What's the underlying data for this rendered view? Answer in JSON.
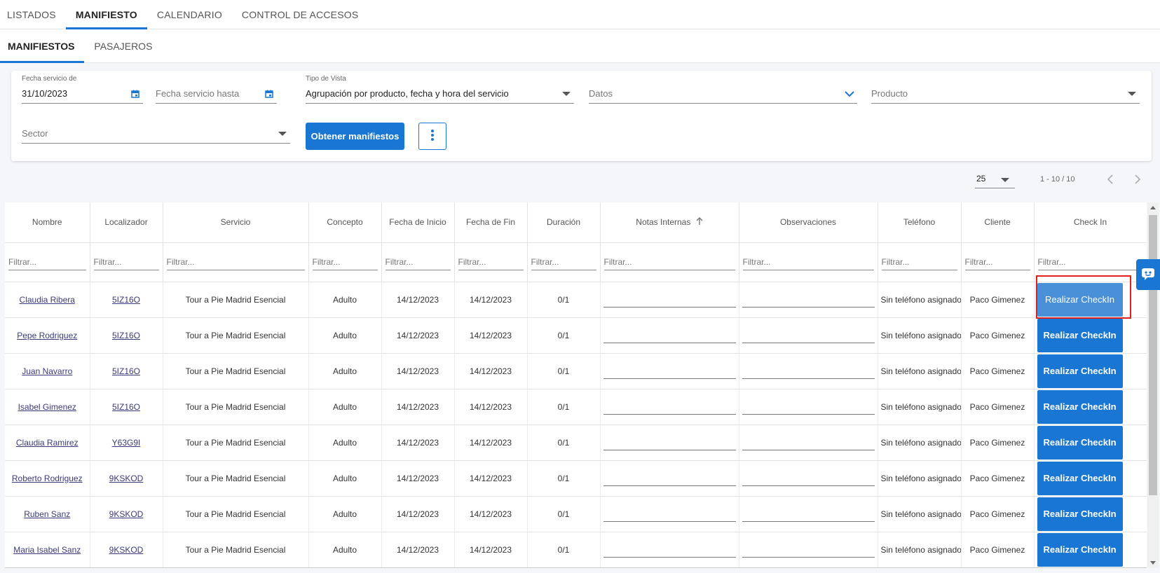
{
  "top_tabs": [
    "LISTADOS",
    "MANIFIESTO",
    "CALENDARIO",
    "CONTROL DE ACCESOS"
  ],
  "top_tab_active": "MANIFIESTO",
  "sub_tabs": [
    "MANIFIESTOS",
    "PASAJEROS"
  ],
  "sub_tab_active": "MANIFIESTOS",
  "filters": {
    "fecha_desde_label": "Fecha servicio de",
    "fecha_desde_value": "31/10/2023",
    "fecha_hasta_placeholder": "Fecha servicio hasta",
    "tipo_vista_label": "Tipo de Vista",
    "tipo_vista_value": "Agrupación por producto, fecha y hora del servicio",
    "datos_placeholder": "Datos",
    "producto_placeholder": "Producto",
    "sector_placeholder": "Sector",
    "obtener_button": "Obtener manifiestos"
  },
  "pagination": {
    "page_size": "25",
    "range": "1 - 10 / 10"
  },
  "table": {
    "columns": [
      "Nombre",
      "Localizador",
      "Servicio",
      "Concepto",
      "Fecha de Inicio",
      "Fecha de Fin",
      "Duración",
      "Notas Internas",
      "Observaciones",
      "Teléfono",
      "Cliente",
      "Check In"
    ],
    "filter_placeholder": "Filtrar...",
    "checkin_label": "Realizar CheckIn",
    "rows": [
      {
        "nombre": "Claudia Ribera",
        "localizador": "5IZ16O",
        "servicio": "Tour a Pie Madrid Esencial",
        "concepto": "Adulto",
        "inicio": "14/12/2023",
        "fin": "14/12/2023",
        "duracion": "0/1",
        "telefono": "Sin teléfono asignado",
        "cliente": "Paco Gimenez"
      },
      {
        "nombre": "Pepe Rodriguez",
        "localizador": "5IZ16O",
        "servicio": "Tour a Pie Madrid Esencial",
        "concepto": "Adulto",
        "inicio": "14/12/2023",
        "fin": "14/12/2023",
        "duracion": "0/1",
        "telefono": "Sin teléfono asignado",
        "cliente": "Paco Gimenez"
      },
      {
        "nombre": "Juan Navarro",
        "localizador": "5IZ16O",
        "servicio": "Tour a Pie Madrid Esencial",
        "concepto": "Adulto",
        "inicio": "14/12/2023",
        "fin": "14/12/2023",
        "duracion": "0/1",
        "telefono": "Sin teléfono asignado",
        "cliente": "Paco Gimenez"
      },
      {
        "nombre": "Isabel Gimenez",
        "localizador": "5IZ16O",
        "servicio": "Tour a Pie Madrid Esencial",
        "concepto": "Adulto",
        "inicio": "14/12/2023",
        "fin": "14/12/2023",
        "duracion": "0/1",
        "telefono": "Sin teléfono asignado",
        "cliente": "Paco Gimenez"
      },
      {
        "nombre": "Claudia Ramirez",
        "localizador": "Y63G9I",
        "servicio": "Tour a Pie Madrid Esencial",
        "concepto": "Adulto",
        "inicio": "14/12/2023",
        "fin": "14/12/2023",
        "duracion": "0/1",
        "telefono": "Sin teléfono asignado",
        "cliente": "Paco Gimenez"
      },
      {
        "nombre": "Roberto Rodriguez",
        "localizador": "9KSKOD",
        "servicio": "Tour a Pie Madrid Esencial",
        "concepto": "Adulto",
        "inicio": "14/12/2023",
        "fin": "14/12/2023",
        "duracion": "0/1",
        "telefono": "Sin teléfono asignado",
        "cliente": "Paco Gimenez"
      },
      {
        "nombre": "Ruben Sanz",
        "localizador": "9KSKOD",
        "servicio": "Tour a Pie Madrid Esencial",
        "concepto": "Adulto",
        "inicio": "14/12/2023",
        "fin": "14/12/2023",
        "duracion": "0/1",
        "telefono": "Sin teléfono asignado",
        "cliente": "Paco Gimenez"
      },
      {
        "nombre": "Maria Isabel Sanz",
        "localizador": "9KSKOD",
        "servicio": "Tour a Pie Madrid Esencial",
        "concepto": "Adulto",
        "inicio": "14/12/2023",
        "fin": "14/12/2023",
        "duracion": "0/1",
        "telefono": "Sin teléfono asignado",
        "cliente": "Paco Gimenez"
      }
    ]
  },
  "colors": {
    "accent": "#1976d2",
    "highlight": "#e0201e"
  }
}
